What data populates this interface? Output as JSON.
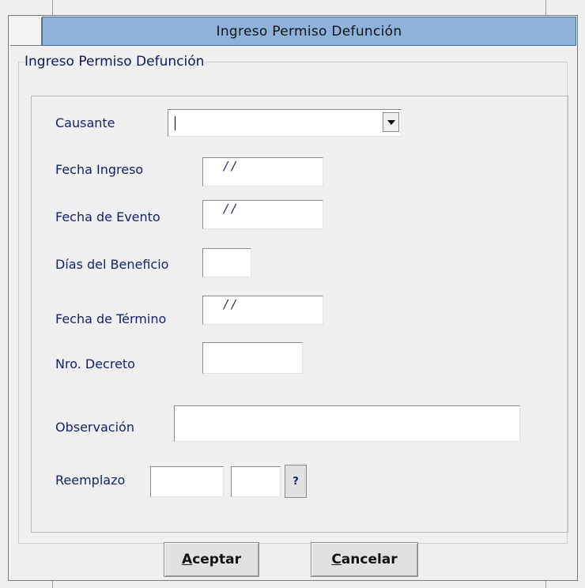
{
  "window": {
    "title": "Ingreso Permiso Defunción"
  },
  "group": {
    "title": "Ingreso Permiso Defunción"
  },
  "form": {
    "causante_label": "Causante",
    "causante_value": "",
    "fecha_ingreso_label": "Fecha Ingreso",
    "fecha_ingreso_value": "/ /",
    "fecha_evento_label": "Fecha de Evento",
    "fecha_evento_value": "/ /",
    "dias_beneficio_label": "Días del Beneficio",
    "dias_beneficio_value": "",
    "fecha_termino_label": "Fecha de Término",
    "fecha_termino_value": "/ /",
    "nro_decreto_label": "Nro. Decreto",
    "nro_decreto_value": "",
    "observacion_label": "Observación",
    "observacion_value": "",
    "reemplazo_label": "Reemplazo",
    "reemplazo_value_1": "",
    "reemplazo_value_2": "",
    "reemplazo_lookup_label": "?"
  },
  "buttons": {
    "aceptar_accel": "A",
    "aceptar_rest": "ceptar",
    "cancelar_accel": "C",
    "cancelar_rest": "ancelar"
  },
  "icons": {
    "causante_dropdown": "chevron-down-icon"
  },
  "colors": {
    "titlebar": "#8db3dc",
    "label_text": "#14226e",
    "window_bg": "#f0f0f0"
  }
}
